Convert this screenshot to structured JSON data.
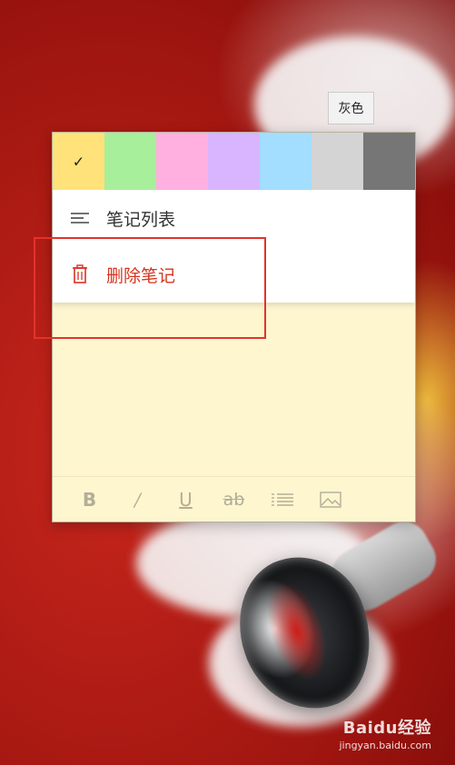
{
  "tooltip": {
    "text": "灰色"
  },
  "colors": [
    {
      "name": "yellow",
      "hex": "#ffe27a",
      "selected": true
    },
    {
      "name": "green",
      "hex": "#a7ef9a",
      "selected": false
    },
    {
      "name": "pink",
      "hex": "#ffafe0",
      "selected": false
    },
    {
      "name": "purple",
      "hex": "#d8b5fe",
      "selected": false
    },
    {
      "name": "blue",
      "hex": "#a3ddff",
      "selected": false
    },
    {
      "name": "gray",
      "hex": "#d4d4d4",
      "selected": false
    },
    {
      "name": "charcoal",
      "hex": "#767676",
      "selected": false
    }
  ],
  "selected_mark": "✓",
  "menu": {
    "note_list": {
      "label": "笔记列表",
      "icon": "list-icon"
    },
    "delete_note": {
      "label": "删除笔记",
      "icon": "trash-icon",
      "color": "#d8341f"
    }
  },
  "toolbar": {
    "bold": "B",
    "italic": "/",
    "underline": "U",
    "strikethrough": "ab",
    "bullets_icon": "bullet-list-icon",
    "image_icon": "image-icon"
  },
  "watermark": {
    "brand": "Baidu经验",
    "url": "jingyan.baidu.com"
  }
}
